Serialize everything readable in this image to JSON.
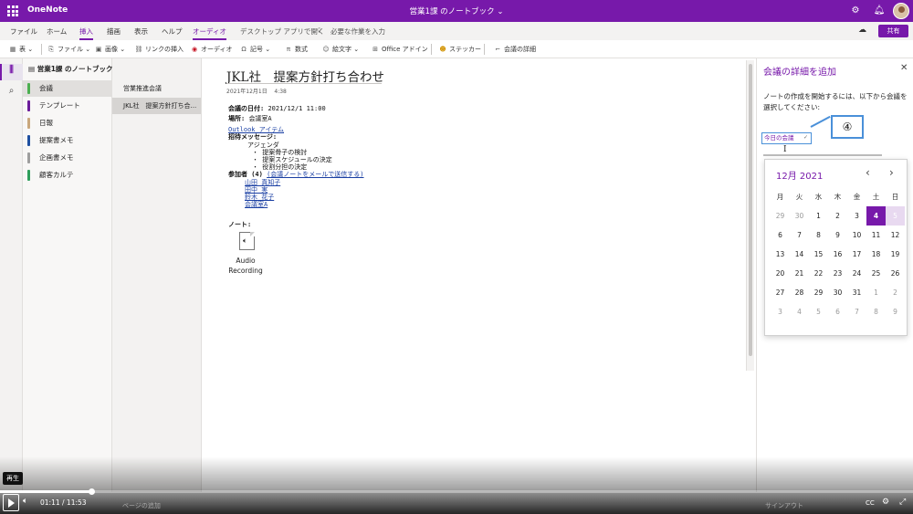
{
  "titlebar": {
    "app_name": "OneNote",
    "doc_title": "営業1課 のノートブック ⌄",
    "settings_icon": "gear-icon",
    "bell_icon": "bell-icon"
  },
  "menubar": {
    "items": [
      "ファイル",
      "ホーム",
      "挿入",
      "描画",
      "表示",
      "ヘルプ",
      "オーディオ",
      "デスクトップ アプリで開く"
    ],
    "active": "挿入",
    "search_placeholder": "必要な作業を入力",
    "share_label": "共有"
  },
  "ribbon": {
    "table": "表 ⌄",
    "file": "ファイル ⌄",
    "image": "画像 ⌄",
    "link": "リンクの挿入",
    "audio": "オーディオ",
    "symbol": "記号 ⌄",
    "equation": "数式",
    "emoji": "絵文字 ⌄",
    "office_addin": "Office アドイン",
    "sticker": "ステッカー",
    "meeting_details": "会議の詳細"
  },
  "notebook": {
    "name": "営業1課 のノートブック ⌄",
    "sections": [
      {
        "label": "会議",
        "color": "#4caf50"
      },
      {
        "label": "テンプレート",
        "color": "#6a1b9a"
      },
      {
        "label": "日報",
        "color": "#c9a77c"
      },
      {
        "label": "提案書メモ",
        "color": "#1e4fa0"
      },
      {
        "label": "企画書メモ",
        "color": "#9e9e9e"
      },
      {
        "label": "顧客カルテ",
        "color": "#2e9e5b"
      }
    ],
    "selected_section": 0,
    "pages": [
      "営業推進会議",
      "JKL社　提案方針打ち合..."
    ],
    "selected_page": 1,
    "add_page": "ページの追加"
  },
  "note": {
    "title": "JKL社　提案方針打ち合わせ",
    "date": "2021年12月1日",
    "time": "4:38",
    "lines": {
      "datetime_label": "会議の日付:",
      "datetime_value": "2021/12/1 11:00",
      "location_label": "場所:",
      "location_value": "会議室A",
      "outlook_link": "Outlook アイテム",
      "invite_label": "招待メッセージ:",
      "agenda": "アジェンダ",
      "agenda_items": [
        "提案骨子の検討",
        "提案スケジュールの決定",
        "役割分担の決定"
      ],
      "attendees_label": "参加者 (4)",
      "attendees_link": "(会議ノートをメールで送信する)",
      "attendees": [
        "山田 真知子",
        "田中 実",
        "鈴木 花子",
        "会議室A"
      ],
      "notes_label": "ノート:"
    },
    "audio": {
      "label_line1": "Audio",
      "label_line2": "Recording"
    }
  },
  "meeting_pane": {
    "title": "会議の詳細を追加",
    "description": "ノートの作成を開始するには、以下から会議を選択してください:",
    "dropdown": "今日の会議",
    "callout_number": "④",
    "signout": "サインアウト",
    "calendar": {
      "month_label": "12月 2021",
      "weekdays": [
        "月",
        "火",
        "水",
        "木",
        "金",
        "土",
        "日"
      ],
      "weeks": [
        [
          "29",
          "30",
          "1",
          "2",
          "3",
          "4",
          "5"
        ],
        [
          "6",
          "7",
          "8",
          "9",
          "10",
          "11",
          "12"
        ],
        [
          "13",
          "14",
          "15",
          "16",
          "17",
          "18",
          "19"
        ],
        [
          "20",
          "21",
          "22",
          "23",
          "24",
          "25",
          "26"
        ],
        [
          "27",
          "28",
          "29",
          "30",
          "31",
          "1",
          "2"
        ],
        [
          "3",
          "4",
          "5",
          "6",
          "7",
          "8",
          "9"
        ]
      ],
      "today": "4"
    }
  },
  "player": {
    "tooltip": "再生",
    "current_time": "01:11",
    "total_time": "11:53",
    "progress": 0.1
  }
}
